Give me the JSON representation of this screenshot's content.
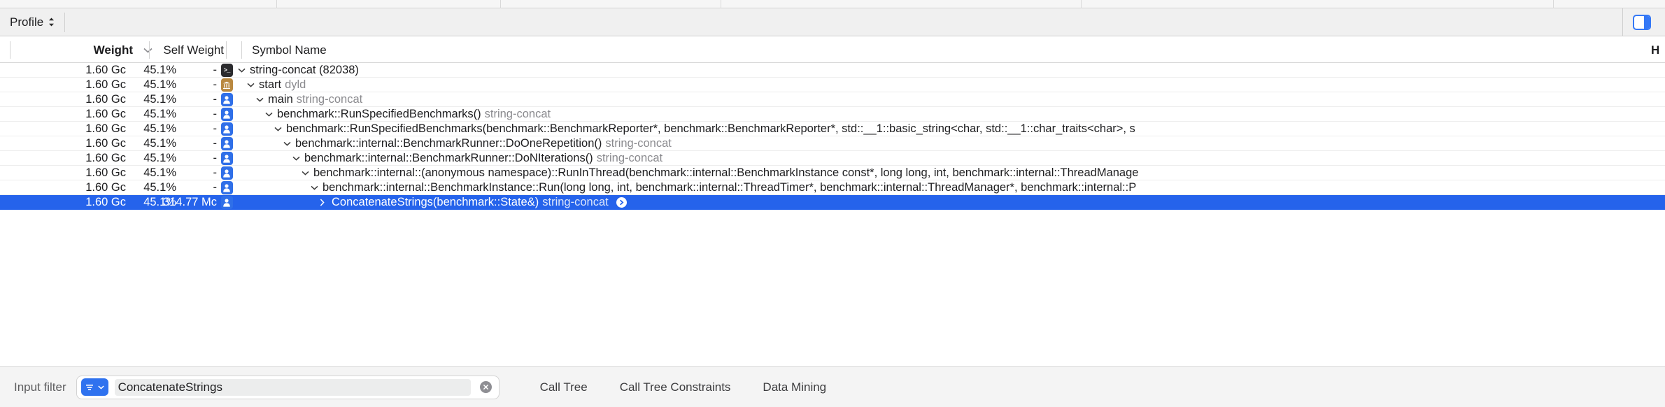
{
  "window": {
    "profile_label": "Profile",
    "sidebar_toggle_icon": "right-panel-icon",
    "accent_color": "#2563eb"
  },
  "table": {
    "columns": {
      "weight": "Weight",
      "self_weight": "Self Weight",
      "symbol_name": "Symbol Name",
      "far_right": "H",
      "sort_indicator": "chevron-down-icon"
    },
    "rows": [
      {
        "weight": "1.60 Gc",
        "percent": "45.1%",
        "self_weight": "-",
        "icon": "terminal-process-icon",
        "icon_kind": "term",
        "disclosure": "expanded",
        "depth": 0,
        "symbol": "string-concat (82038)",
        "module": "",
        "selected": false,
        "focus_button": false
      },
      {
        "weight": "1.60 Gc",
        "percent": "45.1%",
        "self_weight": "-",
        "icon": "library-icon",
        "icon_kind": "lib",
        "disclosure": "expanded",
        "depth": 1,
        "symbol": "start",
        "module": "dyld",
        "selected": false,
        "focus_button": false
      },
      {
        "weight": "1.60 Gc",
        "percent": "45.1%",
        "self_weight": "-",
        "icon": "user-code-icon",
        "icon_kind": "user",
        "disclosure": "expanded",
        "depth": 2,
        "symbol": "main",
        "module": "string-concat",
        "selected": false,
        "focus_button": false
      },
      {
        "weight": "1.60 Gc",
        "percent": "45.1%",
        "self_weight": "-",
        "icon": "user-code-icon",
        "icon_kind": "user",
        "disclosure": "expanded",
        "depth": 3,
        "symbol": "benchmark::RunSpecifiedBenchmarks()",
        "module": "string-concat",
        "selected": false,
        "focus_button": false
      },
      {
        "weight": "1.60 Gc",
        "percent": "45.1%",
        "self_weight": "-",
        "icon": "user-code-icon",
        "icon_kind": "user",
        "disclosure": "expanded",
        "depth": 4,
        "symbol": "benchmark::RunSpecifiedBenchmarks(benchmark::BenchmarkReporter*, benchmark::BenchmarkReporter*, std::__1::basic_string<char, std::__1::char_traits<char>, s",
        "module": "",
        "selected": false,
        "focus_button": false
      },
      {
        "weight": "1.60 Gc",
        "percent": "45.1%",
        "self_weight": "-",
        "icon": "user-code-icon",
        "icon_kind": "user",
        "disclosure": "expanded",
        "depth": 5,
        "symbol": "benchmark::internal::BenchmarkRunner::DoOneRepetition()",
        "module": "string-concat",
        "selected": false,
        "focus_button": false
      },
      {
        "weight": "1.60 Gc",
        "percent": "45.1%",
        "self_weight": "-",
        "icon": "user-code-icon",
        "icon_kind": "user",
        "disclosure": "expanded",
        "depth": 6,
        "symbol": "benchmark::internal::BenchmarkRunner::DoNIterations()",
        "module": "string-concat",
        "selected": false,
        "focus_button": false
      },
      {
        "weight": "1.60 Gc",
        "percent": "45.1%",
        "self_weight": "-",
        "icon": "user-code-icon",
        "icon_kind": "user",
        "disclosure": "expanded",
        "depth": 7,
        "symbol": "benchmark::internal::(anonymous namespace)::RunInThread(benchmark::internal::BenchmarkInstance const*, long long, int, benchmark::internal::ThreadManage",
        "module": "",
        "selected": false,
        "focus_button": false
      },
      {
        "weight": "1.60 Gc",
        "percent": "45.1%",
        "self_weight": "-",
        "icon": "user-code-icon",
        "icon_kind": "user",
        "disclosure": "expanded",
        "depth": 8,
        "symbol": "benchmark::internal::BenchmarkInstance::Run(long long, int, benchmark::internal::ThreadTimer*, benchmark::internal::ThreadManager*, benchmark::internal::P",
        "module": "",
        "selected": false,
        "focus_button": false
      },
      {
        "weight": "1.60 Gc",
        "percent": "45.1%",
        "self_weight": "314.77 Mc",
        "icon": "user-code-icon",
        "icon_kind": "user",
        "disclosure": "collapsed",
        "depth": 9,
        "symbol": "ConcatenateStrings(benchmark::State&)",
        "module": "string-concat",
        "selected": true,
        "focus_button": true
      }
    ]
  },
  "bottom_bar": {
    "input_filter_label": "Input filter",
    "filter_token_icon": "filter-menu-icon",
    "filter_value": "ConcatenateStrings",
    "filter_placeholder": "Input filter",
    "clear_icon": "clear-circle-icon",
    "buttons": [
      {
        "label": "Call Tree"
      },
      {
        "label": "Call Tree Constraints"
      },
      {
        "label": "Data Mining"
      }
    ]
  }
}
